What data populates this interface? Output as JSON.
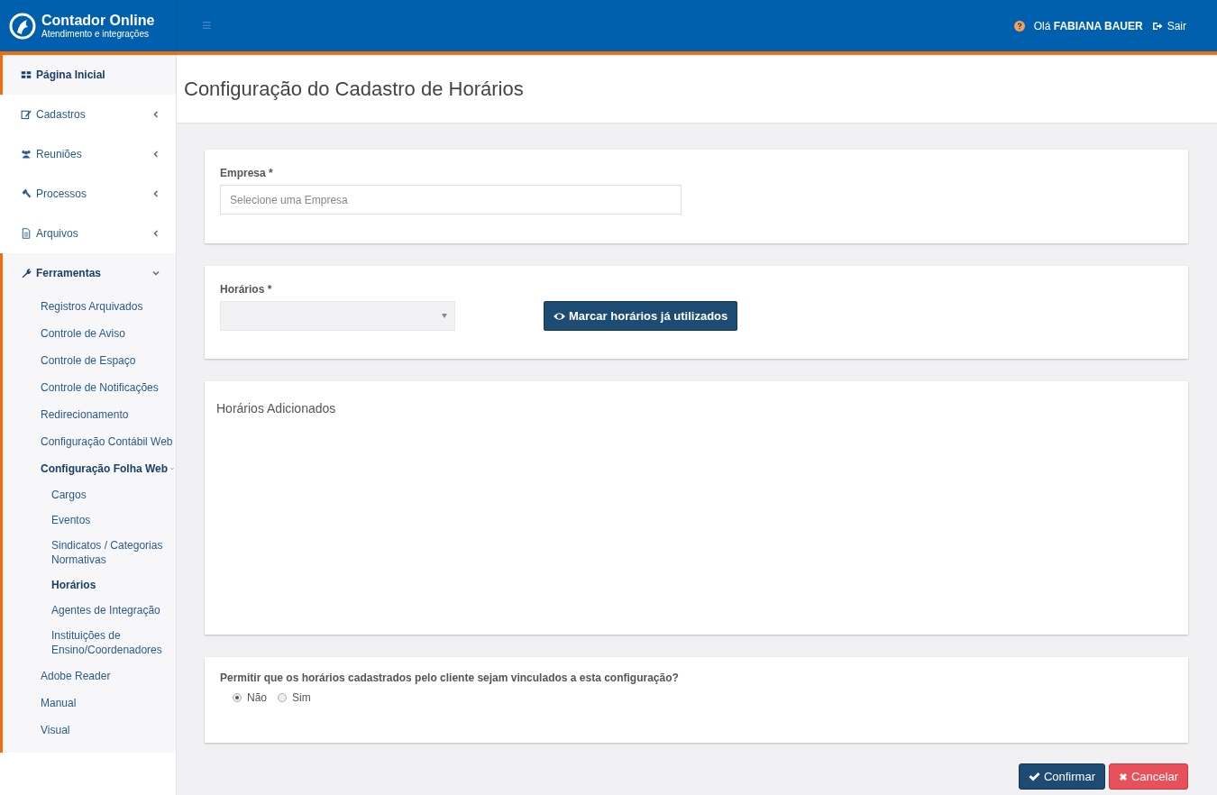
{
  "brand": {
    "title": "Contador Online",
    "subtitle": "Atendimento e integrações"
  },
  "header": {
    "menu_glyph": "≡",
    "greeting": "Olá",
    "user": "FABIANA BAUER",
    "logout": "Sair"
  },
  "sidebar": {
    "items": [
      {
        "label": "Página Inicial",
        "selected": true
      },
      {
        "label": "Cadastros",
        "selected": false,
        "expanded": false
      },
      {
        "label": "Reuniões",
        "selected": false,
        "expanded": false
      },
      {
        "label": "Processos",
        "selected": false,
        "expanded": false
      },
      {
        "label": "Arquivos",
        "selected": false,
        "expanded": false
      },
      {
        "label": "Ferramentas",
        "expanded": true,
        "children": [
          {
            "label": "Registros Arquivados",
            "selected": false
          },
          {
            "label": "Controle de Aviso",
            "selected": false
          },
          {
            "label": "Controle de Espaço",
            "selected": false
          },
          {
            "label": "Controle de Notificações",
            "selected": false
          },
          {
            "label": "Redirecionamento",
            "selected": false
          },
          {
            "label": "Configuração Contábil Web",
            "selected": false
          },
          {
            "label": "Configuração Folha Web",
            "expanded": true,
            "children": [
              {
                "label": "Cargos",
                "selected": false
              },
              {
                "label": "Eventos",
                "selected": false
              },
              {
                "label": "Sindicatos / Categorias Normativas",
                "selected": false
              },
              {
                "label": "Horários",
                "selected": true
              },
              {
                "label": "Agentes de Integração",
                "selected": false
              },
              {
                "label": "Instituições de Ensino/Coordenadores",
                "selected": false
              }
            ]
          },
          {
            "label": "Adobe Reader",
            "selected": false
          },
          {
            "label": "Manual",
            "selected": false
          },
          {
            "label": "Visual",
            "selected": false
          }
        ]
      }
    ]
  },
  "page_title": "Configuração do Cadastro de Horários",
  "empresa": {
    "label": "Empresa *",
    "placeholder": "Selecione uma Empresa"
  },
  "horarios": {
    "label": "Horários *",
    "disabled": true,
    "button": "Marcar horários já utilizados"
  },
  "added_panel": {
    "title": "Horários Adicionados"
  },
  "permit": {
    "question": "Permitir que os horários cadastrados pelo cliente sejam vinculados a esta configuração?",
    "options": [
      {
        "label": "Não",
        "selected": true
      },
      {
        "label": "Sim",
        "selected": false
      }
    ]
  },
  "actions": {
    "confirm": "Confirmar",
    "cancel": "Cancelar"
  }
}
